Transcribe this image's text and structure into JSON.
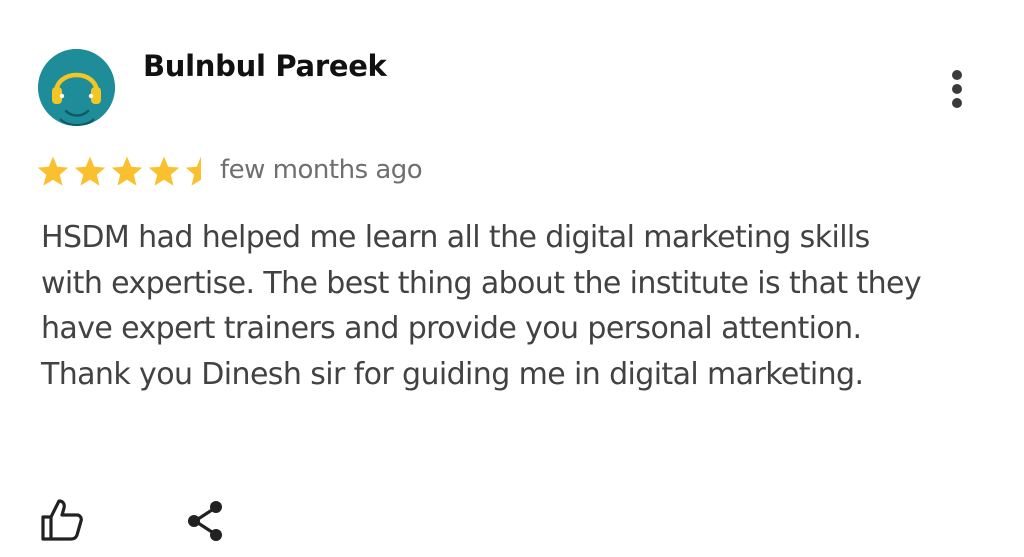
{
  "review": {
    "author_name": "Bulnbul Pareek",
    "rating": 4.5,
    "rating_max": 5,
    "time_ago": "few months ago",
    "text_lines": [
      "HSDM had helped me learn all the digital marketing skills",
      "with expertise. The best thing about the institute is that they",
      "have expert trainers and provide you personal attention.",
      "Thank you Dinesh sir for guiding me in digital marketing."
    ]
  },
  "icons": {
    "avatar": "headphones-avatar-icon",
    "more": "more-vertical-icon",
    "like": "thumbs-up-icon",
    "share": "share-icon"
  },
  "colors": {
    "star_filled": "#fbc02d",
    "avatar_bg": "#1f8c99",
    "text_primary": "#111111",
    "text_body": "#424242",
    "text_secondary": "#6f6f6f"
  }
}
